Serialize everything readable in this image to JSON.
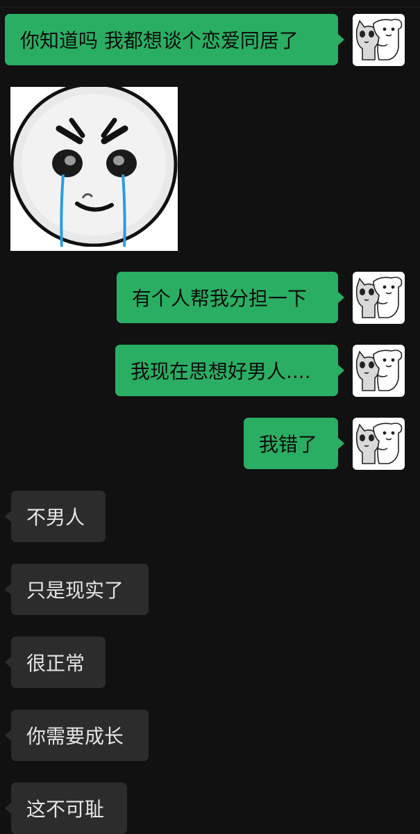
{
  "chat": {
    "messages": [
      {
        "direction": "out",
        "text": "你知道吗 我都想谈个恋爱同居了"
      },
      {
        "direction": "in",
        "type": "sticker",
        "sticker": "crying-face-sticker"
      },
      {
        "direction": "out",
        "text": "有个人帮我分担一下"
      },
      {
        "direction": "out",
        "text": "我现在思想好男人...."
      },
      {
        "direction": "out",
        "text": "我错了"
      },
      {
        "direction": "in",
        "text": "不男人"
      },
      {
        "direction": "in",
        "text": "只是现实了"
      },
      {
        "direction": "in",
        "text": "很正常"
      },
      {
        "direction": "in",
        "text": "你需要成长"
      },
      {
        "direction": "in",
        "text": "这不可耻"
      }
    ]
  },
  "colors": {
    "background": "#111111",
    "outgoing_bubble": "#2aae63",
    "incoming_bubble": "#2c2c2c",
    "incoming_text": "#e6e6e6",
    "tear_blue": "#2b9be0"
  },
  "icons": {
    "self_avatar": "two-cartoon-cats-avatar"
  }
}
